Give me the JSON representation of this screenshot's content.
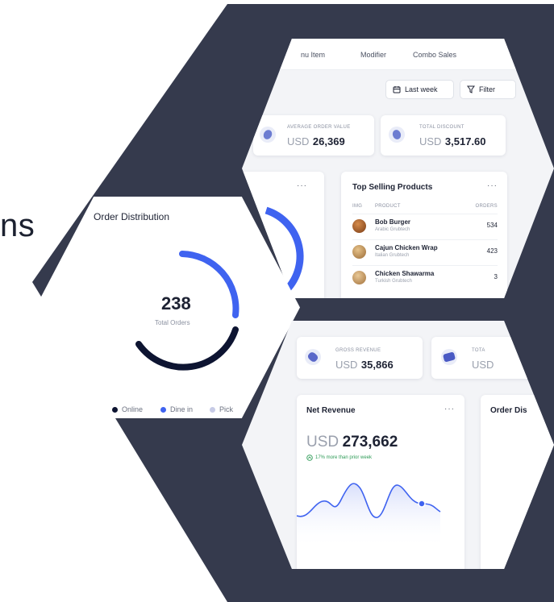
{
  "heading_fragment": "ns",
  "colors": {
    "frame": "#353a4d",
    "online": "#0d1431",
    "dine_in": "#3f63f0",
    "pickup": "#c7cbe6",
    "accent": "#3f63f0",
    "positive": "#2e9b57"
  },
  "top_panel": {
    "tabs": [
      "nu Item",
      "Modifier",
      "Combo Sales"
    ],
    "last_week_label": "Last week",
    "filter_label": "Filter",
    "calendar_icon": "calendar-icon",
    "filter_icon": "filter-icon",
    "avg_order": {
      "label": "AVERAGE ORDER VALUE",
      "currency": "USD",
      "value": "26,369"
    },
    "total_discount": {
      "label": "TOTAL DISCOUNT",
      "currency": "USD",
      "value": "3,517.60"
    },
    "more_menu": "···",
    "top_selling": {
      "title": "Top Selling Products",
      "more": "···",
      "col_img": "IMG",
      "col_product": "PRODUCT",
      "col_orders": "ORDERS",
      "rows": [
        {
          "name": "Bob Burger",
          "sub": "Arabic Grubtech",
          "orders": "534"
        },
        {
          "name": "Cajun Chicken Wrap",
          "sub": "Italian Grubtech",
          "orders": "423"
        },
        {
          "name": "Chicken Shawarma",
          "sub": "Turkish Grubtech",
          "orders": "3"
        }
      ]
    }
  },
  "order_distribution": {
    "title": "Order Distribution",
    "total": "238",
    "total_label": "Total Orders",
    "legend": [
      "Online",
      "Dine in",
      "Pick"
    ]
  },
  "bottom_panel": {
    "gross_revenue": {
      "label": "GROSS REVENUE",
      "currency": "USD",
      "value": "35,866"
    },
    "total_partial": {
      "label": "TOTA",
      "currency": "USD"
    },
    "net_revenue": {
      "title": "Net Revenue",
      "more": "···",
      "currency": "USD",
      "value": "273,662",
      "delta": "17% more than prior week"
    },
    "order_dist_partial_title": "Order Dis"
  }
}
